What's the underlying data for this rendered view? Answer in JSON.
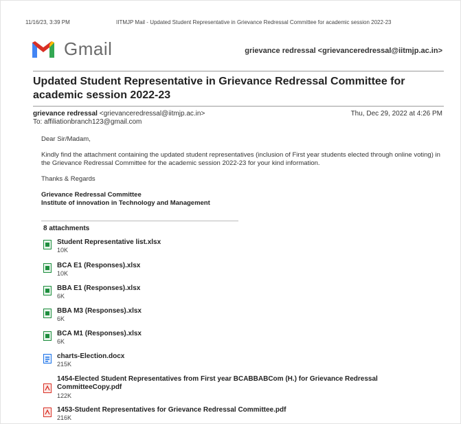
{
  "print_header": {
    "datetime": "11/16/23, 3:39 PM",
    "page_title": "IITMJP Mail - Updated Student Representative in Grievance Redressal Committee for academic session 2022-23"
  },
  "brand": {
    "name": "Gmail"
  },
  "account": "grievance redressal <grievanceredressal@iitmjp.ac.in>",
  "message": {
    "subject": "Updated Student Representative in Grievance Redressal Committee for academic session 2022-23",
    "from_name": "grievance redressal",
    "from_email": "<grievanceredressal@iitmjp.ac.in>",
    "to": "To: affiliationbranch123@gmail.com",
    "date": "Thu, Dec 29, 2022 at 4:26 PM",
    "greeting": "Dear Sir/Madam,",
    "body": "Kindly find the attachment containing the updated student representatives (inclusion of First year students elected through online voting)  in the Grievance Redressal Committee for the academic session 2022-23  for your kind information.",
    "closing": "Thanks & Regards",
    "sig_line1": "Grievance Redressal Committee",
    "sig_line2": "Institute of innovation in Technology and Management"
  },
  "attachments_header": "8 attachments",
  "attachments": [
    {
      "name": "Student Representative list.xlsx",
      "size": "10K",
      "type": "xlsx"
    },
    {
      "name": "BCA E1 (Responses).xlsx",
      "size": "10K",
      "type": "xlsx"
    },
    {
      "name": "BBA E1 (Responses).xlsx",
      "size": "6K",
      "type": "xlsx"
    },
    {
      "name": "BBA M3 (Responses).xlsx",
      "size": "6K",
      "type": "xlsx"
    },
    {
      "name": "BCA M1 (Responses).xlsx",
      "size": "6K",
      "type": "xlsx"
    },
    {
      "name": "charts-Election.docx",
      "size": "215K",
      "type": "docx"
    },
    {
      "name": "1454-Elected Student Representatives from First year BCABBABCom (H.) for Grievance Redressal CommitteeCopy.pdf",
      "size": "122K",
      "type": "pdf"
    },
    {
      "name": "1453-Student Representatives for Grievance Redressal Committee.pdf",
      "size": "216K",
      "type": "pdf"
    }
  ],
  "colors": {
    "gmail_red": "#d93025",
    "xlsx_green": "#1e8e3e",
    "docx_blue": "#1a73e8",
    "pdf_red": "#d93025"
  }
}
